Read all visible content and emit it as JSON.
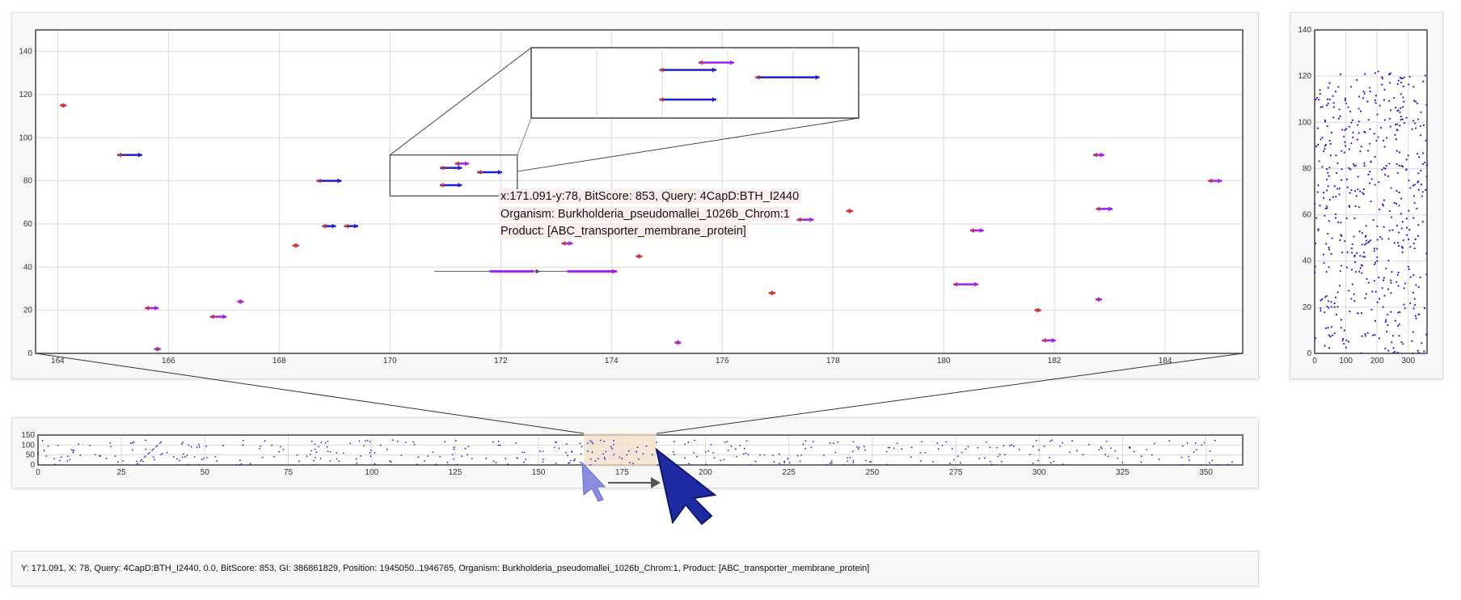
{
  "chart_data": [
    {
      "name": "main-zoom-plot",
      "type": "scatter",
      "x_range": [
        163.6,
        185.4
      ],
      "y_range": [
        0,
        150
      ],
      "xticks": [
        "164",
        "166",
        "168",
        "170",
        "172",
        "174",
        "176",
        "178",
        "180",
        "182",
        "184"
      ],
      "yticks": [
        "0",
        "20",
        "40",
        "60",
        "80",
        "100",
        "120",
        "140"
      ],
      "grid": true,
      "hits": [
        {
          "x": 164.1,
          "y": 115,
          "w": 0.08,
          "color": "#d92f2f"
        },
        {
          "x": 165.3,
          "y": 92,
          "w": 0.45,
          "color": "#1f1fcc"
        },
        {
          "x": 165.7,
          "y": 21,
          "w": 0.25,
          "color": "#a020f0"
        },
        {
          "x": 165.8,
          "y": 2,
          "w": 0.12,
          "color": "#a020f0"
        },
        {
          "x": 166.9,
          "y": 17,
          "w": 0.3,
          "color": "#a020f0"
        },
        {
          "x": 167.3,
          "y": 24,
          "w": 0.1,
          "color": "#a020f0"
        },
        {
          "x": 168.3,
          "y": 50,
          "w": 0.1,
          "color": "#d92f2f"
        },
        {
          "x": 168.9,
          "y": 80,
          "w": 0.45,
          "color": "#1f1fcc"
        },
        {
          "x": 168.9,
          "y": 59,
          "w": 0.25,
          "color": "#1f1fcc"
        },
        {
          "x": 169.3,
          "y": 59,
          "w": 0.25,
          "color": "#1f1fcc"
        },
        {
          "x": 171.1,
          "y": 86,
          "w": 0.4,
          "color": "#1f1fcc"
        },
        {
          "x": 171.8,
          "y": 84,
          "w": 0.45,
          "color": "#1f1fcc"
        },
        {
          "x": 171.1,
          "y": 78,
          "w": 0.4,
          "color": "#1f1fcc"
        },
        {
          "x": 171.3,
          "y": 88,
          "w": 0.25,
          "color": "#a020f0"
        },
        {
          "x": 173.2,
          "y": 51,
          "w": 0.2,
          "color": "#a020f0"
        },
        {
          "x": 174.5,
          "y": 45,
          "w": 0.1,
          "color": "#d92f2f"
        },
        {
          "x": 175.2,
          "y": 5,
          "w": 0.1,
          "color": "#a020f0"
        },
        {
          "x": 176.9,
          "y": 28,
          "w": 0.1,
          "color": "#d92f2f"
        },
        {
          "x": 177.5,
          "y": 62,
          "w": 0.3,
          "color": "#a020f0"
        },
        {
          "x": 178.3,
          "y": 66,
          "w": 0.1,
          "color": "#d92f2f"
        },
        {
          "x": 180.4,
          "y": 32,
          "w": 0.45,
          "color": "#a020f0"
        },
        {
          "x": 180.6,
          "y": 57,
          "w": 0.25,
          "color": "#a020f0"
        },
        {
          "x": 181.7,
          "y": 20,
          "w": 0.1,
          "color": "#d92f2f"
        },
        {
          "x": 181.9,
          "y": 6,
          "w": 0.25,
          "color": "#a020f0"
        },
        {
          "x": 182.8,
          "y": 92,
          "w": 0.2,
          "color": "#a020f0"
        },
        {
          "x": 182.9,
          "y": 67,
          "w": 0.3,
          "color": "#a020f0"
        },
        {
          "x": 182.8,
          "y": 25,
          "w": 0.1,
          "color": "#a020f0"
        },
        {
          "x": 184.9,
          "y": 80,
          "w": 0.25,
          "color": "#a020f0"
        }
      ],
      "highlight_hit": {
        "x": 172.3,
        "y": 38,
        "x_start": 170.8,
        "x_end": 174.1,
        "segments": [
          [
            171.8,
            172.6
          ],
          [
            173.2,
            174.1
          ]
        ],
        "color": "#a020f0"
      },
      "inset_box": {
        "x_range": [
          170.0,
          172.3
        ],
        "y_range": [
          73,
          92
        ]
      },
      "inset_view": {
        "x_range": [
          170.0,
          172.3
        ],
        "y_range": [
          73,
          92
        ]
      }
    },
    {
      "name": "overview-strip",
      "type": "scatter",
      "x_range": [
        0,
        361
      ],
      "y_range": [
        0,
        150
      ],
      "xticks": [
        "0",
        "25",
        "50",
        "75",
        "100",
        "125",
        "150",
        "175",
        "200",
        "225",
        "250",
        "275",
        "300",
        "325",
        "350"
      ],
      "yticks": [
        "0",
        "50",
        "100",
        "150"
      ],
      "brush": {
        "x_range": [
          163.6,
          185.4
        ]
      },
      "point_count": 420,
      "point_seed": 7
    },
    {
      "name": "side-plot",
      "type": "scatter",
      "x_range": [
        0,
        360
      ],
      "y_range": [
        0,
        140
      ],
      "xticks": [
        "0",
        "100",
        "200",
        "300"
      ],
      "yticks": [
        "0",
        "20",
        "40",
        "60",
        "80",
        "100",
        "120",
        "140"
      ],
      "point_count": 520,
      "point_seed": 13
    }
  ],
  "tooltip": {
    "line1": "x:171.091-y:78, BitScore: 853, Query: 4CapD:BTH_I2440",
    "line2": "Organism: Burkholderia_pseudomallei_1026b_Chrom:1",
    "line3": "Product: [ABC_transporter_membrane_protein]"
  },
  "status": "Y: 171.091, X: 78, Query: 4CapD:BTH_I2440, 0.0, BitScore: 853, GI: 386861829, Position: 1945050..1946765, Organism: Burkholderia_pseudomallei_1026b_Chrom:1, Product: [ABC_transporter_membrane_protein]",
  "colors": {
    "blue": "#1f1fcc",
    "purple": "#a020f0",
    "red": "#d92f2f",
    "brush": "#f2dcc5",
    "grid": "#d9d9d9",
    "cursor": "#2233aa"
  },
  "icons": [
    "cursor-arrow-icon",
    "drag-arrow-icon"
  ]
}
